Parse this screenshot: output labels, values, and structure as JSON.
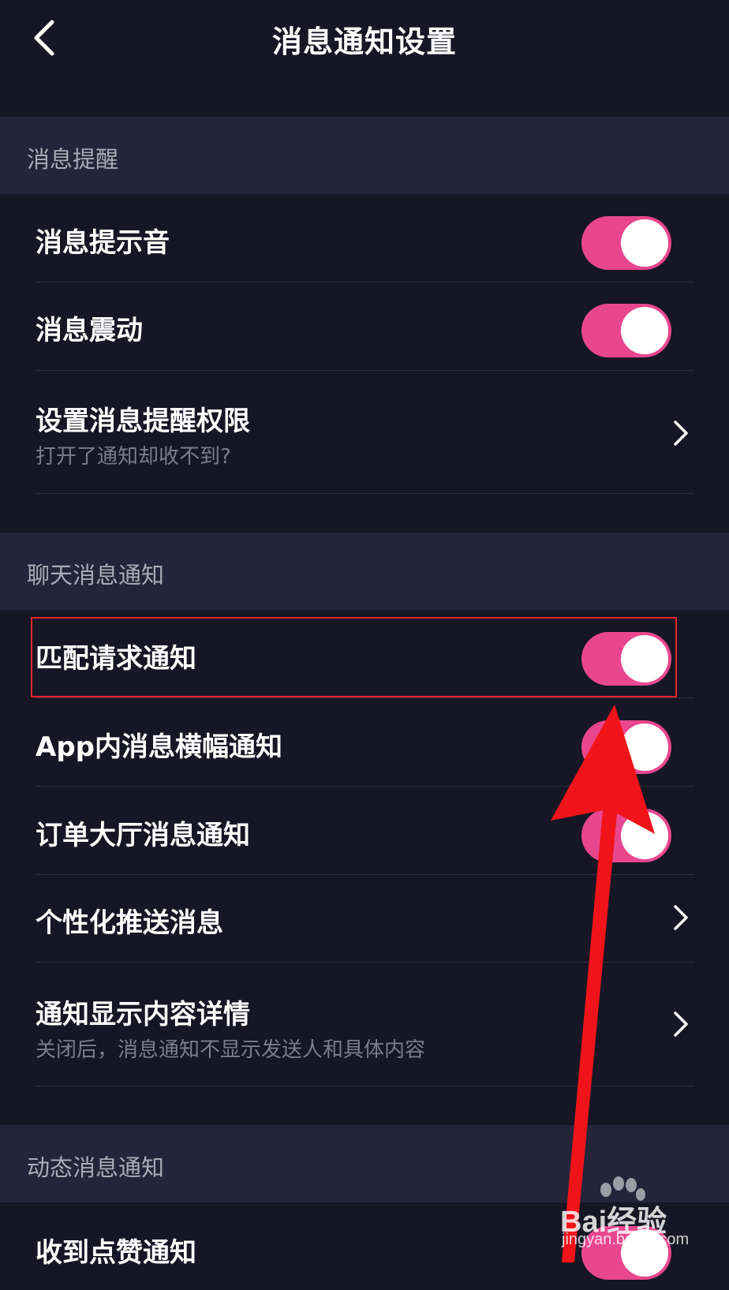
{
  "header": {
    "title": "消息通知设置",
    "back_icon": "back-chevron-icon"
  },
  "sections": [
    {
      "title": "消息提醒",
      "items": [
        {
          "label": "消息提示音",
          "control": "toggle",
          "on": true
        },
        {
          "label": "消息震动",
          "control": "toggle",
          "on": true
        },
        {
          "label": "设置消息提醒权限",
          "sublabel": "打开了通知却收不到?",
          "control": "chevron"
        }
      ]
    },
    {
      "title": "聊天消息通知",
      "items": [
        {
          "label": "匹配请求通知",
          "control": "toggle",
          "on": true
        },
        {
          "label": "App内消息横幅通知",
          "control": "toggle",
          "on": true
        },
        {
          "label": "订单大厅消息通知",
          "control": "toggle",
          "on": true
        },
        {
          "label": "个性化推送消息",
          "control": "chevron"
        },
        {
          "label": "通知显示内容详情",
          "sublabel": "关闭后，消息通知不显示发送人和具体内容",
          "control": "chevron"
        }
      ]
    },
    {
      "title": "动态消息通知",
      "items": [
        {
          "label": "收到点赞通知",
          "control": "toggle",
          "on": true
        }
      ]
    }
  ],
  "annotation": {
    "highlight_color": "#e4262b",
    "arrow_color": "#f0141a"
  },
  "watermark": {
    "brand": "Bai经验",
    "url": "jingyan.baidu.com"
  },
  "colors": {
    "background": "#161625",
    "section_bg": "#24253a",
    "toggle_on": "#e8478f"
  }
}
